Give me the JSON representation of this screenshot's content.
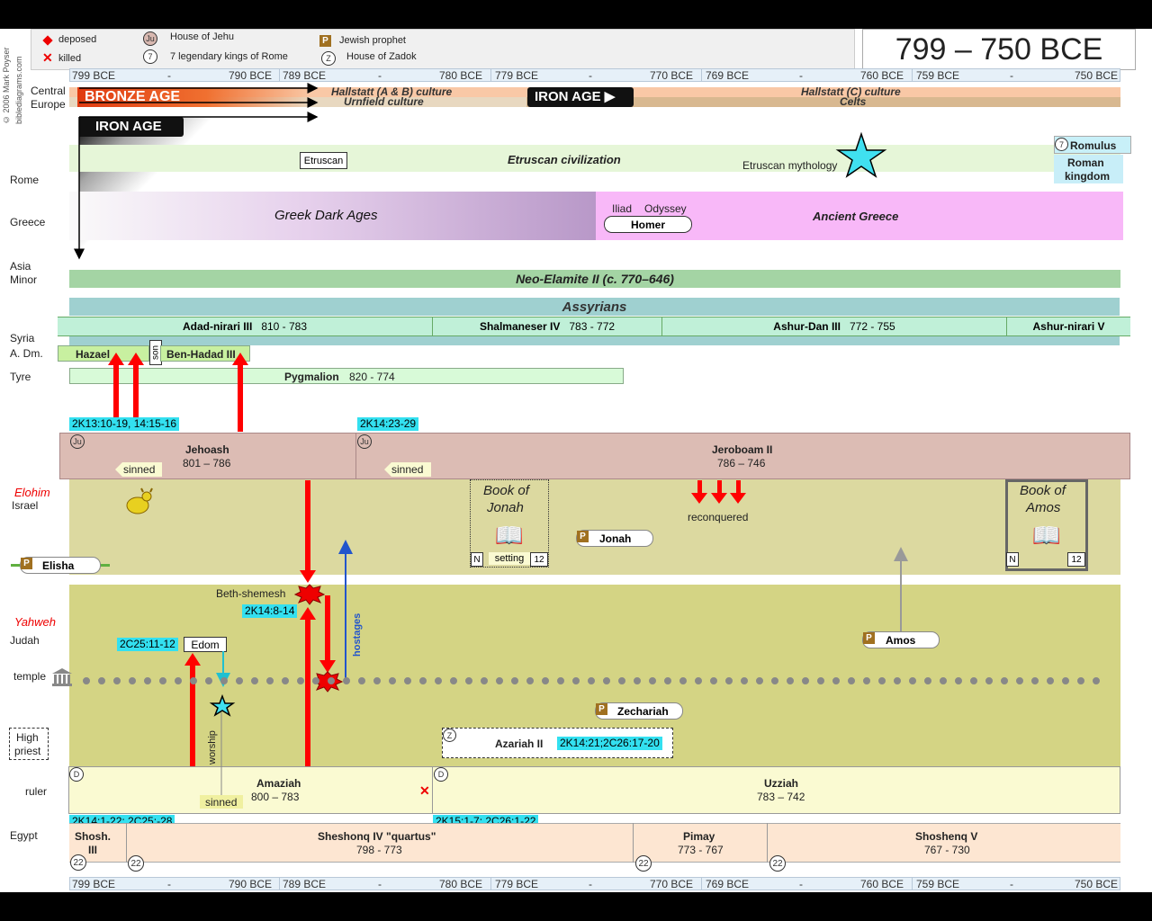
{
  "title": "799 – 750 BCE",
  "copyright": "© 2006 Mark Poyser",
  "site": "biblediagrams.com",
  "legend": {
    "deposed": "deposed",
    "killed": "killed",
    "jehu_badge": "Ju",
    "house_of_jehu": "House of Jehu",
    "seven_badge": "7",
    "seven_kings": "7 legendary kings of Rome",
    "prophet_badge": "P",
    "jewish_prophet": "Jewish prophet",
    "zadok_badge": "Z",
    "house_of_zadok": "House of Zadok"
  },
  "timeline_ticks": [
    "799 BCE",
    "-",
    "790 BCE",
    "789 BCE",
    "-",
    "780 BCE",
    "779 BCE",
    "-",
    "770 BCE",
    "769 BCE",
    "-",
    "760 BCE",
    "759 BCE",
    "-",
    "750 BCE"
  ],
  "row_labels": {
    "central": "Central",
    "europe": "Europe",
    "rome": "Rome",
    "greece": "Greece",
    "asia": "Asia",
    "minor": "Minor",
    "syria": "Syria",
    "adm": "A. Dm.",
    "tyre": "Tyre",
    "elohim": "Elohim",
    "israel": "Israel",
    "yahweh": "Yahweh",
    "judah": "Judah",
    "temple": "temple",
    "high": "High",
    "priest": "priest",
    "ruler": "ruler",
    "egypt": "Egypt"
  },
  "europe": {
    "bronze_age": "BRONZE AGE",
    "iron_age_left": "IRON AGE",
    "iron_age_right": "IRON AGE ▶",
    "hallstatt_ab": "Hallstatt (A & B) culture",
    "urnfield": "Urnfield culture",
    "hallstatt_c": "Hallstatt (C) culture",
    "celts": "Celts"
  },
  "rome": {
    "etruscan": "Etruscan",
    "etruscan_civ": "Etruscan civilization",
    "etruscan_myth": "Etruscan mythology",
    "romulus_badge": "7",
    "romulus": "Romulus",
    "roman_kingdom_1": "Roman",
    "roman_kingdom_2": "kingdom"
  },
  "greece": {
    "dark_ages": "Greek Dark Ages",
    "iliad": "Iliad",
    "odyssey": "Odyssey",
    "homer": "Homer",
    "ancient": "Ancient Greece"
  },
  "asia": {
    "elamite": "Neo-Elamite II (c. 770–646)"
  },
  "assyria": {
    "title": "Assyrians",
    "k1": "Adad-nirari III",
    "k1d": "810 - 783",
    "k2": "Shalmaneser IV",
    "k2d": "783 - 772",
    "k3": "Ashur-Dan III",
    "k3d": "772 - 755",
    "k4": "Ashur-nirari V"
  },
  "syria": {
    "hazael": "Hazael",
    "son": "son",
    "benhadad": "Ben-Hadad III"
  },
  "tyre": {
    "pygmalion": "Pygmalion",
    "dates": "820 - 774"
  },
  "israel": {
    "ref1": "2K13:10-19, 14:15-16",
    "ref2": "2K14:23-29",
    "jehoash": "Jehoash",
    "jehoash_dates": "801 – 786",
    "jeroboam": "Jeroboam II",
    "jeroboam_dates": "786 – 746",
    "sinned": "sinned",
    "jonah_book_1": "Book of",
    "jonah_book_2": "Jonah",
    "jonah_n": "N",
    "jonah_setting": "setting",
    "jonah_num": "12",
    "jonah": "Jonah",
    "reconquered": "reconquered",
    "amos_book_1": "Book of",
    "amos_book_2": "Amos",
    "amos_n": "N",
    "amos_num": "12",
    "elisha": "Elisha",
    "jehu_badge": "Ju"
  },
  "judah": {
    "beth_shemesh": "Beth-shemesh",
    "ref_bs": "2K14:8-14",
    "hostages": "hostages",
    "ref_edom": "2C25:11-12",
    "edom": "Edom",
    "worship": "worship",
    "sinned": "sinned",
    "amos": "Amos",
    "zechariah": "Zechariah",
    "azariah": "Azariah II",
    "azariah_ref": "2K14:21;2C26:17-20",
    "zadok_badge": "Z",
    "amaziah": "Amaziah",
    "amaziah_dates": "800 – 783",
    "uzziah": "Uzziah",
    "uzziah_dates": "783 – 742",
    "d_badge": "D",
    "ref_amaziah": "2K14:1-22;  2C25:-28",
    "ref_uzziah": "2K15:1-7;  2C26:1-22"
  },
  "egypt": {
    "shosh": "Shosh.",
    "shosh_num": "III",
    "sheshonq4": "Sheshonq IV \"quartus\"",
    "sheshonq4_dates": "798 - 773",
    "pimay": "Pimay",
    "pimay_dates": "773 - 767",
    "shosheng5": "Shoshenq V",
    "shosheng5_dates": "767 - 730",
    "dyn": "22"
  },
  "colors": {
    "reference": "#33e0f0",
    "arrow": "#ff0000",
    "israel_band": "#dcd9a0",
    "ruler_band": "#fafad2",
    "egypt_band": "#fde6d2",
    "greece_band": "#f8b8f8",
    "assyria_band": "#9fd0d0"
  }
}
